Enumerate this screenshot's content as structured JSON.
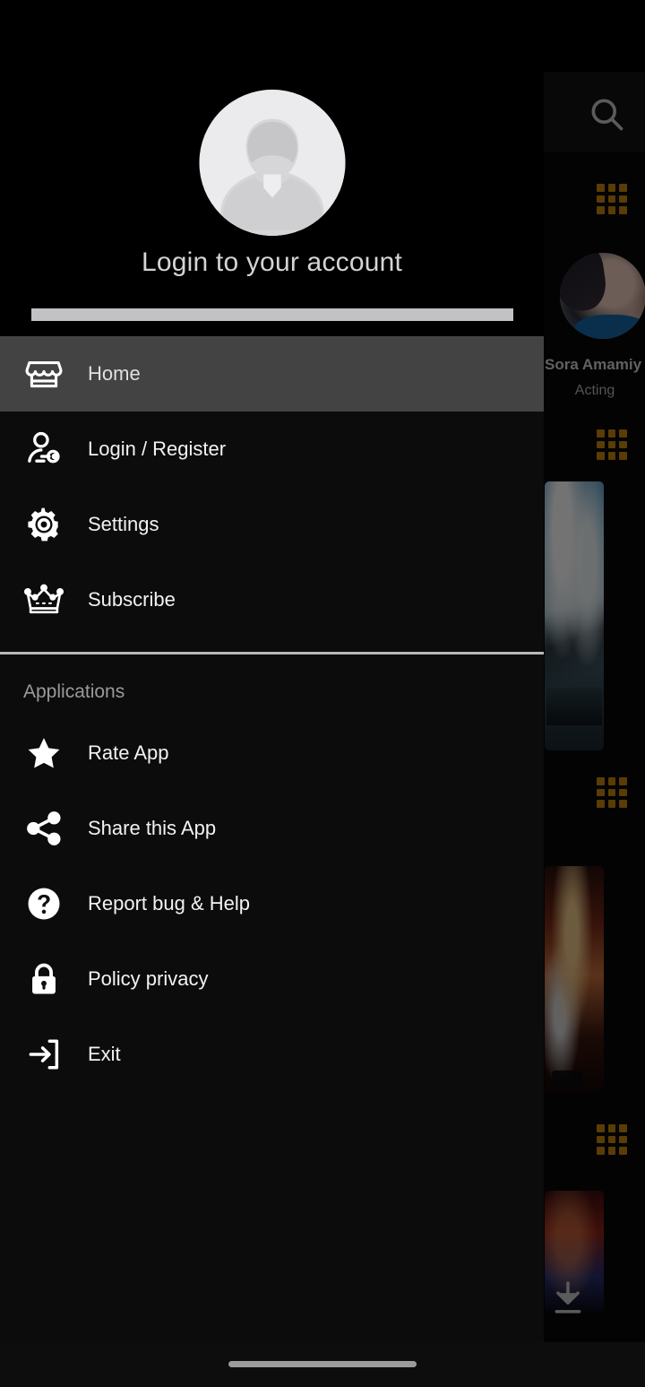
{
  "drawer": {
    "header": {
      "avatar_icon": "default-user-avatar",
      "title": "Login to your account"
    },
    "primary_items": [
      {
        "label": "Home",
        "icon": "storefront-icon",
        "selected": true
      },
      {
        "label": "Login / Register",
        "icon": "user-key-icon",
        "selected": false
      },
      {
        "label": "Settings",
        "icon": "gear-icon",
        "selected": false
      },
      {
        "label": "Subscribe",
        "icon": "crown-icon",
        "selected": false
      }
    ],
    "section_label": "Applications",
    "application_items": [
      {
        "label": "Rate App",
        "icon": "star-icon"
      },
      {
        "label": "Share this App",
        "icon": "share-icon"
      },
      {
        "label": "Report bug & Help",
        "icon": "question-circle-icon"
      },
      {
        "label": "Policy privacy",
        "icon": "lock-icon"
      },
      {
        "label": "Exit",
        "icon": "exit-arrow-icon"
      }
    ]
  },
  "background_app": {
    "search_icon": "search-icon",
    "grid_icon": "grid-3x3-icon",
    "download_icon": "download-icon",
    "person": {
      "name": "Sora Amamiy",
      "role": "Acting"
    }
  },
  "colors": {
    "drawer_background": "#0c0c0c",
    "header_background": "#000000",
    "selected_row": "#434343",
    "label_text": "#f2f2f2",
    "section_text": "#9a9a9a",
    "divider": "#b9b9b9",
    "accent_grid": "#c8860d"
  },
  "system": {
    "nav_handle": "gesture-nav-handle"
  }
}
